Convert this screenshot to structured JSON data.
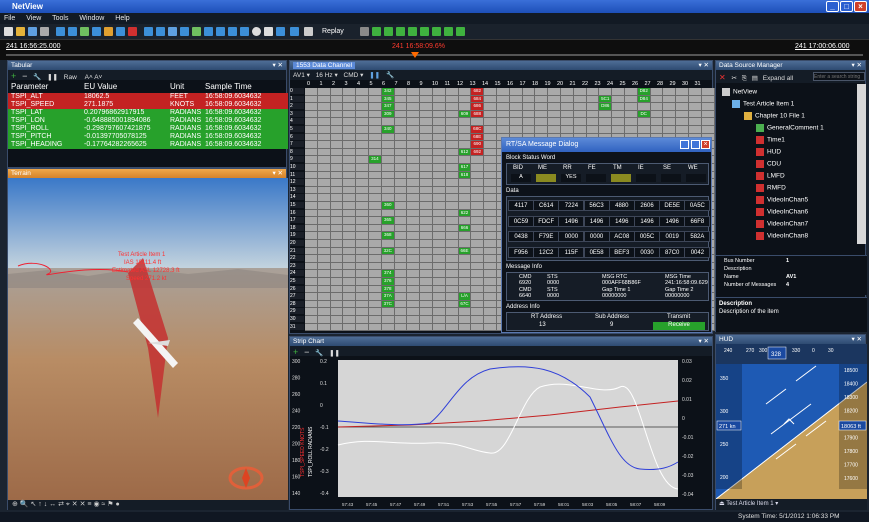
{
  "app": {
    "title": "NetView"
  },
  "menu": [
    "File",
    "View",
    "Tools",
    "Window",
    "Help"
  ],
  "toolbar": {
    "replay_label": "Replay"
  },
  "timeline": {
    "start": "241 16:56:25.000",
    "current": "241 16:58:09.6%",
    "end": "241 17:00:06.000"
  },
  "tabular": {
    "title": "Tabular",
    "raw_label": "Raw",
    "columns": [
      "Parameter",
      "EU Value",
      "Unit",
      "Sample Time"
    ],
    "rows": [
      {
        "param": "TSPI_ALT",
        "eu": "18062.5",
        "unit": "FEET",
        "time": "16:58:09.6034632",
        "color": "#c42222"
      },
      {
        "param": "TSPI_SPEED",
        "eu": "271.1875",
        "unit": "KNOTS",
        "time": "16:58:09.6034632",
        "color": "#c42222"
      },
      {
        "param": "TSPI_LAT",
        "eu": "0.20796862917915",
        "unit": "RADIANS",
        "time": "16:58:09.6034632",
        "color": "#27a12b"
      },
      {
        "param": "TSPI_LON",
        "eu": "-0.648885001894086",
        "unit": "RADIANS",
        "time": "16:58:09.6034632",
        "color": "#27a12b"
      },
      {
        "param": "TSPI_ROLL",
        "eu": "-0.298797607421875",
        "unit": "RADIANS",
        "time": "16:58:09.6034632",
        "color": "#27a12b"
      },
      {
        "param": "TSPI_PITCH",
        "eu": "-0.01397705078125",
        "unit": "RADIANS",
        "time": "16:58:09.6034632",
        "color": "#27a12b"
      },
      {
        "param": "TSPI_HEADING",
        "eu": "-0.17764282265625",
        "unit": "RADIANS",
        "time": "16:58:09.6034632",
        "color": "#27a12b"
      }
    ]
  },
  "terrain": {
    "title": "Terrain",
    "labels": [
      "Test Article Item 1",
      "IAS 18111.4 ft",
      "Estimated ASL 12728.3 ft",
      "Speed 271.2 kt"
    ]
  },
  "channel": {
    "title": "1553 Data Channel",
    "bus": "AV1",
    "rate": "16 Hz",
    "cmd": "CMD",
    "cols": [
      "0",
      "1",
      "2",
      "3",
      "4",
      "5",
      "6",
      "7",
      "8",
      "9",
      "10",
      "11",
      "12",
      "13",
      "14",
      "15",
      "16",
      "17",
      "18",
      "19",
      "20",
      "21",
      "22",
      "23",
      "24",
      "25",
      "26",
      "27",
      "28",
      "29",
      "30",
      "31"
    ],
    "cells": [
      [
        0,
        6,
        "g",
        "342"
      ],
      [
        0,
        13,
        "r",
        "682"
      ],
      [
        0,
        26,
        "g",
        "D82"
      ],
      [
        1,
        6,
        "g",
        "345"
      ],
      [
        1,
        13,
        "r",
        "684"
      ],
      [
        1,
        23,
        "g",
        "5C1"
      ],
      [
        1,
        26,
        "g",
        "D84"
      ],
      [
        2,
        6,
        "g",
        "347"
      ],
      [
        2,
        13,
        "r",
        "686"
      ],
      [
        2,
        23,
        "g",
        "D86"
      ],
      [
        3,
        6,
        "g",
        "309"
      ],
      [
        3,
        12,
        "g",
        "609"
      ],
      [
        3,
        13,
        "r",
        "688"
      ],
      [
        3,
        26,
        "g",
        "DC"
      ],
      [
        5,
        6,
        "g",
        "340"
      ],
      [
        5,
        13,
        "r",
        "68C"
      ],
      [
        6,
        13,
        "r",
        "68E"
      ],
      [
        7,
        13,
        "r",
        "690"
      ],
      [
        8,
        12,
        "g",
        "612"
      ],
      [
        8,
        13,
        "r",
        "692"
      ],
      [
        9,
        5,
        "g",
        "314"
      ],
      [
        10,
        12,
        "g",
        "617"
      ],
      [
        11,
        12,
        "g",
        "618"
      ],
      [
        15,
        6,
        "g",
        "360"
      ],
      [
        16,
        12,
        "g",
        "622"
      ],
      [
        17,
        6,
        "g",
        "365"
      ],
      [
        18,
        12,
        "g",
        "666"
      ],
      [
        19,
        6,
        "g",
        "368"
      ],
      [
        21,
        6,
        "g",
        "32C"
      ],
      [
        21,
        12,
        "g",
        "66E"
      ],
      [
        24,
        6,
        "g",
        "374"
      ],
      [
        25,
        6,
        "g",
        "376"
      ],
      [
        26,
        6,
        "g",
        "378"
      ],
      [
        27,
        6,
        "g",
        "37A"
      ],
      [
        27,
        12,
        "g",
        "L/A"
      ],
      [
        28,
        6,
        "g",
        "37C"
      ],
      [
        28,
        12,
        "g",
        "67C"
      ]
    ]
  },
  "dialog": {
    "title": "RT/SA Message Dialog",
    "bsw_label": "Block Status Word",
    "bsw_heads": [
      "BID",
      "ME",
      "RR",
      "FE",
      "TM",
      "IE",
      "SE",
      "WE"
    ],
    "bsw_vals": [
      "A",
      "",
      "YES",
      "",
      "",
      "",
      "",
      ""
    ],
    "data_label": "Data",
    "data": [
      [
        "4117",
        "C614",
        "7224",
        "56C3",
        "4880",
        "2606",
        "DE5E",
        "0A5C"
      ],
      [
        "0C59",
        "FDCF",
        "1496",
        "1496",
        "1496",
        "1496",
        "1496",
        "66F8"
      ],
      [
        "0438",
        "F79E",
        "0000",
        "0000",
        "AC08",
        "005C",
        "0019",
        "582A"
      ],
      [
        "F956",
        "12C2",
        "115F",
        "0E58",
        "BEF3",
        "0030",
        "87C0",
        "0042"
      ]
    ],
    "msg_label": "Message Info",
    "msg_heads": [
      "CMD",
      "STS",
      "MSG RTC",
      "MSG Time"
    ],
    "msg_row1": [
      "6920",
      "0000",
      "000AFF68B86F",
      "241:16:58:09.629"
    ],
    "msg_heads2": [
      "CMD",
      "STS",
      "Gap Time 1",
      "Gap Time 2"
    ],
    "msg_row2": [
      "6640",
      "0000",
      "00000000",
      "00000000"
    ],
    "addr_label": "Address Info",
    "addr_heads": [
      "RT Address",
      "Sub Address",
      "Transmit"
    ],
    "addr_vals": [
      "13",
      "9",
      "Receive"
    ]
  },
  "dsm": {
    "title": "Data Source Manager",
    "expand": "Expand all",
    "search_placeholder": "Enter a search string",
    "tree": [
      "NetView",
      "Test Article Item 1",
      "Chapter 10 File 1",
      "GeneralComment 1",
      "Time1",
      "HUD",
      "CDU",
      "LMFD",
      "RMFD",
      "VideoInChan5",
      "VideoInChan6",
      "VideoInChan7",
      "VideoInChan8"
    ],
    "props": [
      [
        "Bus Number",
        "1"
      ],
      [
        "Description",
        ""
      ],
      [
        "Name",
        "AV1"
      ],
      [
        "Number of Messages",
        "4"
      ]
    ],
    "desc_title": "Description",
    "desc_text": "Description of the item"
  },
  "strip": {
    "title": "Strip Chart",
    "ylabel1": "TSPI_SPEED KNOTS",
    "ylabel2": "TSPI_ROLL RADIANS",
    "left_ticks": [
      "300",
      "280",
      "260",
      "240",
      "220",
      "200",
      "180",
      "160",
      "140"
    ],
    "mid_ticks": [
      "0.2",
      "0.1",
      "0",
      "-0.1",
      "-0.2",
      "-0.3",
      "-0.4"
    ],
    "right_ticks": [
      "0.03",
      "0.02",
      "0.01",
      "0",
      "-0.01",
      "-0.02",
      "-0.03",
      "-0.04"
    ],
    "x_ticks": [
      "57:43",
      "57:45",
      "57:47",
      "57:49",
      "57:51",
      "57:53",
      "57:55",
      "57:57",
      "57:59",
      "58:01",
      "58:03",
      "58:05",
      "58:07",
      "58:09"
    ]
  },
  "hud": {
    "title": "HUD",
    "heading": "328",
    "headings": [
      "240",
      "270",
      "300",
      "330",
      "0",
      "30"
    ],
    "speed": "271 kn",
    "alt": "18063 ft",
    "alt_ticks": [
      "18500",
      "18400",
      "18300",
      "18200",
      "18100",
      "17900",
      "17800",
      "17700",
      "17600"
    ],
    "speed_ticks": [
      "350",
      "300",
      "250",
      "200"
    ],
    "footer": "Test Article Item 1"
  },
  "status": {
    "text": "System Time: 5/1/2012 1:06:33 PM"
  },
  "colors": {
    "accent": "#3a6fd8",
    "red": "#c42222",
    "green": "#27a12b",
    "sky": "#1e5ab4",
    "ground": "#c7a05a"
  }
}
